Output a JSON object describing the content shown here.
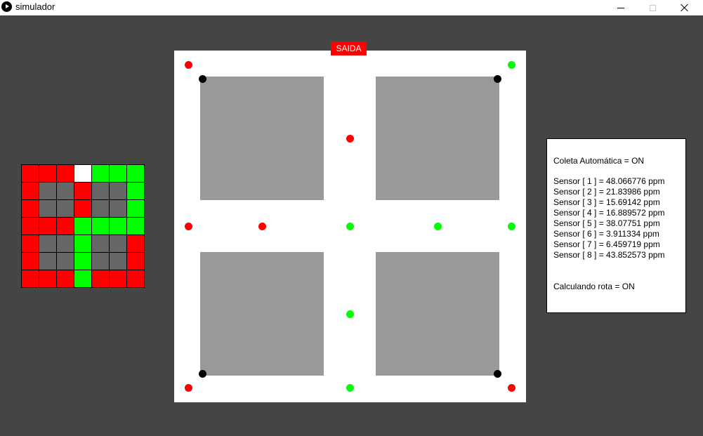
{
  "window": {
    "title": "simulador"
  },
  "colors": {
    "sensor_ok": "#00ff00",
    "sensor_alert": "#ff0000",
    "route_node": "#000000",
    "grid_free": "#ffffff",
    "grid_block": "#666666",
    "building": "#999999",
    "exit": "#ff0000"
  },
  "grid": {
    "rows": [
      [
        "red",
        "red",
        "red",
        "white",
        "green",
        "green",
        "green"
      ],
      [
        "red",
        "gray",
        "gray",
        "red",
        "gray",
        "gray",
        "green"
      ],
      [
        "red",
        "gray",
        "gray",
        "red",
        "gray",
        "gray",
        "green"
      ],
      [
        "red",
        "red",
        "red",
        "green",
        "green",
        "green",
        "green"
      ],
      [
        "red",
        "gray",
        "gray",
        "green",
        "gray",
        "gray",
        "red"
      ],
      [
        "red",
        "gray",
        "gray",
        "green",
        "gray",
        "gray",
        "red"
      ],
      [
        "red",
        "red",
        "red",
        "green",
        "red",
        "red",
        "red"
      ]
    ]
  },
  "map": {
    "exit_label": "SAIDA",
    "dots": [
      {
        "status": "alert"
      },
      {
        "status": "ok"
      },
      {
        "status": "node"
      },
      {
        "status": "node"
      },
      {
        "status": "alert"
      },
      {
        "status": "alert"
      },
      {
        "status": "alert"
      },
      {
        "status": "ok"
      },
      {
        "status": "ok"
      },
      {
        "status": "ok"
      },
      {
        "status": "ok"
      },
      {
        "status": "node"
      },
      {
        "status": "node"
      },
      {
        "status": "alert"
      },
      {
        "status": "ok"
      },
      {
        "status": "alert"
      }
    ]
  },
  "panel": {
    "auto_collect": "Coleta Automática = ON",
    "sensors": [
      "Sensor [ 1 ] = 48.066776 ppm",
      "Sensor [ 2 ] = 21.83986 ppm",
      "Sensor [ 3 ] = 15.69142 ppm",
      "Sensor [ 4 ] = 16.889572 ppm",
      "Sensor [ 5 ] = 38.07751 ppm",
      "Sensor [ 6 ] = 3.911334 ppm",
      "Sensor [ 7 ] = 6.459719 ppm",
      "Sensor [ 8 ] = 43.852573 ppm"
    ],
    "route_status": "Calculando rota = ON"
  }
}
